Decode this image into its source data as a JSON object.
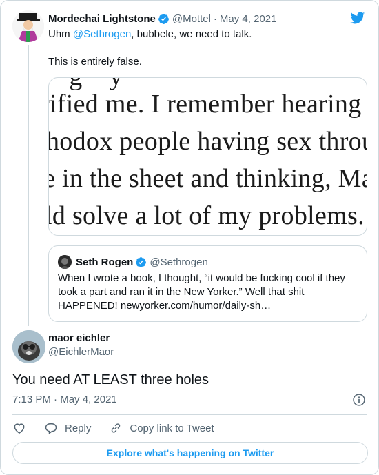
{
  "parent_tweet": {
    "author_name": "Mordechai Lightstone",
    "author_handle": "@Mottel",
    "separator": "·",
    "date": "May 4, 2021",
    "text_prefix": "Uhm ",
    "mention": "@Sethrogen",
    "text_suffix": ", bubbele, we need to talk.",
    "text_line2": "This is entirely false.",
    "media_lines": [
      "rified me. I remember hearing a",
      "hodox people having sex throug",
      "e in the sheet and thinking, Ma",
      "ld solve a lot of my problems."
    ],
    "quoted": {
      "author_name": "Seth Rogen",
      "author_handle": "@Sethrogen",
      "text": "When I wrote a book, I thought, “it would be fucking cool if they took a part and ran it in the New Yorker.” Well that shit HAPPENED! newyorker.com/humor/daily-sh…"
    }
  },
  "main_tweet": {
    "author_name": "maor eichler",
    "author_handle": "@EichlerMaor",
    "text": "You need AT LEAST three holes",
    "time": "7:13 PM",
    "separator": "·",
    "date": "May 4, 2021"
  },
  "actions": {
    "reply_label": "Reply",
    "copy_link_label": "Copy link to Tweet"
  },
  "explore_label": "Explore what's happening on Twitter",
  "icons": {
    "verified": "verified-badge-icon",
    "brand": "twitter-bird-icon",
    "info": "info-icon",
    "like": "heart-icon",
    "reply": "reply-bubble-icon",
    "copy": "link-icon"
  },
  "colors": {
    "accent": "#1d9bf0",
    "text": "#0f1419",
    "secondary": "#536471",
    "border": "#cfd9de"
  }
}
